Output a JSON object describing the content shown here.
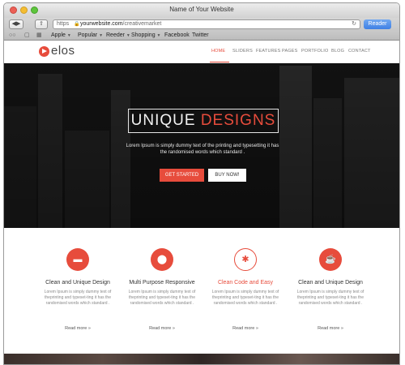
{
  "browser": {
    "window_title": "Name of Your Website",
    "url_prefix": "https",
    "url_domain": "yourwebsite.com",
    "url_path": "/creativemarket",
    "reader_label": "Reader",
    "bookmarks": [
      "Apple",
      "Popular",
      "Reeder",
      "Shopping",
      "Facebook",
      "Twitter"
    ]
  },
  "site": {
    "logo_text": "elos",
    "nav": [
      "HOME",
      "SLIDERS",
      "FEATURES",
      "PAGES",
      "PORTFOLIO",
      "BLOG",
      "CONTACT"
    ],
    "active_nav": "HOME",
    "accent_color": "#e74c3c"
  },
  "hero": {
    "headline_part1": "UNIQUE",
    "headline_part2": "DESIGNS",
    "body": "Lorem Ipsum is simply dummy text of the printing and typesetting it has the randomised words which standard .",
    "primary_button": "GET STARTED",
    "secondary_button": "BUY NOW!"
  },
  "features": [
    {
      "icon": "chat-bubble-icon",
      "title": "Clean and Unique Design",
      "desc": "Lorem Ipsum is simply dummy text of theprinting and typeset-ting it has the randomised words which standard .",
      "link": "Read more",
      "highlighted": false
    },
    {
      "icon": "map-pin-icon",
      "title": "Multi Purpose Responsive",
      "desc": "Lorem Ipsum is simply dummy text of theprinting and typeset-ting it has the randomised words which standard .",
      "link": "Read more",
      "highlighted": false
    },
    {
      "icon": "asterisk-icon",
      "title": "Clean Code and Easy",
      "desc": "Lorem Ipsum is simply dummy text of theprinting and typeset-ting it has the randomised words which standard .",
      "link": "Read more",
      "highlighted": true
    },
    {
      "icon": "coffee-cup-icon",
      "title": "Clean and Unique Design",
      "desc": "Lorem Ipsum is simply dummy text of theprinting and typeset-ting it has the randomised words which standard .",
      "link": "Read more",
      "highlighted": false
    }
  ]
}
